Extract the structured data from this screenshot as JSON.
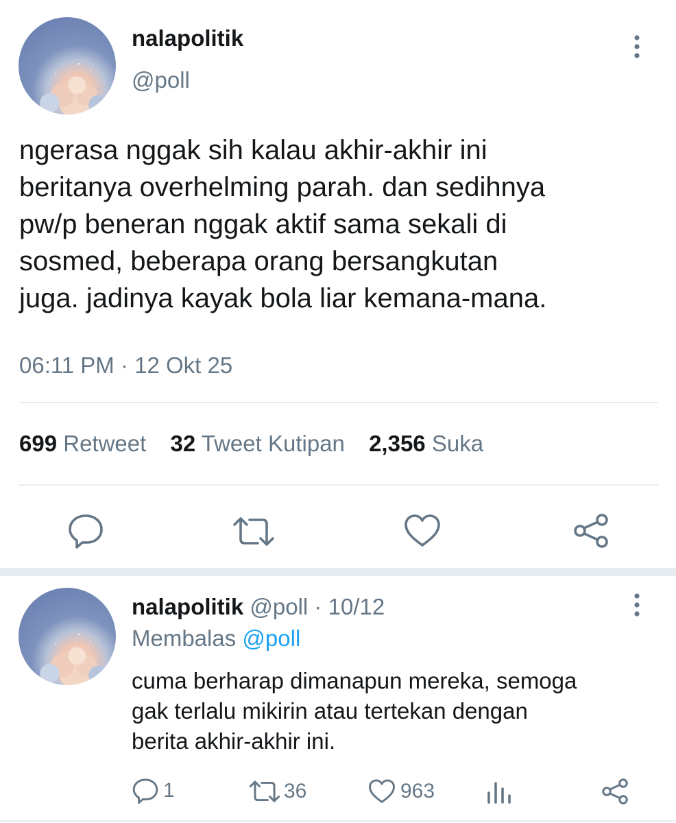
{
  "main_tweet": {
    "display_name": "nalapolitik",
    "handle": "@poll",
    "text_lines": [
      "ngerasa nggak sih kalau akhir-akhir ini",
      "beritanya overhelming parah. dan sedihnya",
      "pw/p beneran nggak aktif sama sekali di",
      "sosmed, beberapa orang bersangkutan",
      "juga. jadinya kayak bola liar kemana-mana."
    ],
    "timestamp": "06:11 PM · 12 Okt 25",
    "stats": {
      "retweets_count": "699",
      "retweets_label": "Retweet",
      "quotes_count": "32",
      "quotes_label": "Tweet Kutipan",
      "likes_count": "2,356",
      "likes_label": "Suka"
    },
    "actions": [
      "reply-icon",
      "retweet-icon",
      "like-icon",
      "share-icon"
    ]
  },
  "reply_tweet": {
    "display_name": "nalapolitik",
    "handle": "@poll",
    "separator": "·",
    "date": "10/12",
    "replying_label": "Membalas",
    "replying_to": "@poll",
    "text_lines": [
      "cuma berharap dimanapun mereka, semoga",
      "gak terlalu mikirin atau tertekan dengan",
      "berita akhir-akhir ini."
    ],
    "actions": {
      "reply_count": "1",
      "retweet_count": "36",
      "like_count": "963"
    }
  },
  "colors": {
    "text": "#14171a",
    "muted": "#657786",
    "link": "#1da1f2",
    "divider": "#e6ecf0"
  }
}
